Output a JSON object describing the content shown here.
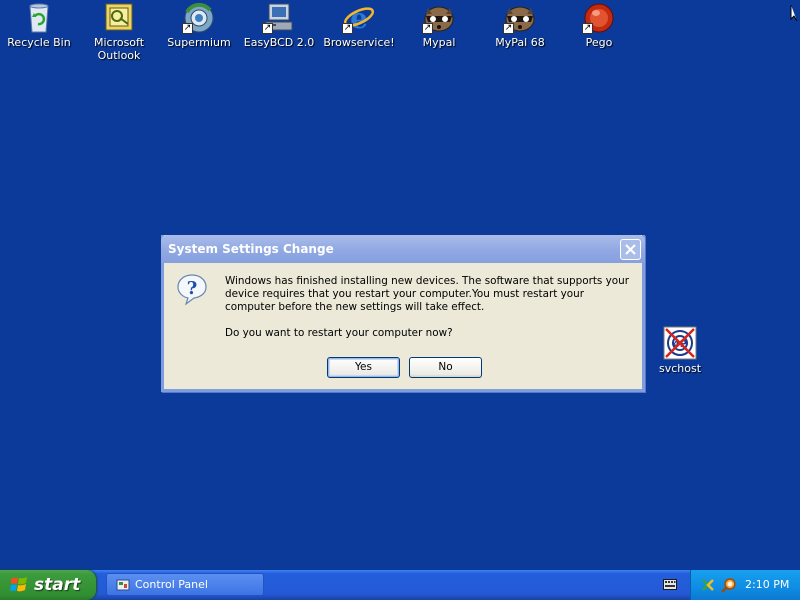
{
  "desktop": {
    "background": "#0b3a9b",
    "icons": [
      {
        "label_line1": "Recycle Bin",
        "label_line2": "",
        "icon": "recycle-bin-icon"
      },
      {
        "label_line1": "Microsoft",
        "label_line2": "Outlook",
        "icon": "outlook-icon"
      },
      {
        "label_line1": "Supermium",
        "label_line2": "",
        "icon": "supermium-icon"
      },
      {
        "label_line1": "EasyBCD 2.0",
        "label_line2": "",
        "icon": "easybcd-icon"
      },
      {
        "label_line1": "Browservice!",
        "label_line2": "",
        "icon": "ie-icon"
      },
      {
        "label_line1": "Mypal",
        "label_line2": "",
        "icon": "mypal-icon"
      },
      {
        "label_line1": "MyPal 68",
        "label_line2": "",
        "icon": "mypal68-icon"
      },
      {
        "label_line1": "Pego",
        "label_line2": "",
        "icon": "pego-icon"
      }
    ],
    "svchost_label": "svchost"
  },
  "dialog": {
    "title": "System Settings Change",
    "message": "Windows has finished installing new devices. The software that supports your device requires that you restart your computer.You must restart your computer before the new settings will take effect.",
    "question": "Do you want to restart your computer now?",
    "yes_label": "Yes",
    "no_label": "No"
  },
  "taskbar": {
    "start_label": "start",
    "task_control_panel": "Control Panel",
    "clock": "2:10 PM"
  },
  "colors": {
    "titlebar": "#90a8e3",
    "dialog_bg": "#ece9d8",
    "taskbar": "#245edb",
    "start_button": "#3c9b3c",
    "tray": "#0f8ce3"
  }
}
